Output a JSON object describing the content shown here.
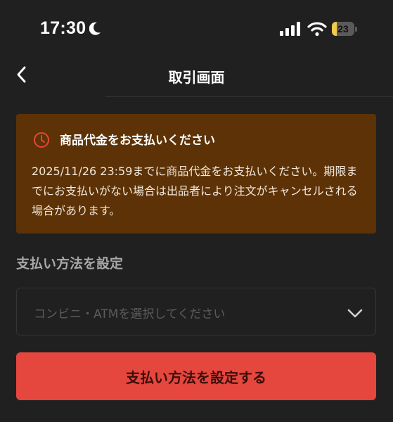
{
  "status_bar": {
    "time": "17:30",
    "battery_level": "23",
    "battery_fraction": 0.23,
    "icons": [
      "moon-icon",
      "signal-icon",
      "wifi-icon",
      "battery-icon"
    ]
  },
  "nav": {
    "back_icon": "chevron-left-icon",
    "title": "取引画面"
  },
  "alert": {
    "icon": "clock-icon",
    "title": "商品代金をお支払いください",
    "body": "2025/11/26 23:59までに商品代金をお支払いください。期限までにお支払いがない場合は出品者により注文がキャンセルされる場合があります。",
    "background_color": "#5c3206",
    "icon_color": "#e5463d"
  },
  "payment": {
    "section_label": "支払い方法を設定",
    "select_placeholder": "コンビニ・ATMを選択してください",
    "select_icon": "chevron-down-icon"
  },
  "primary_button": {
    "label": "支払い方法を設定する",
    "color": "#e5463d"
  }
}
